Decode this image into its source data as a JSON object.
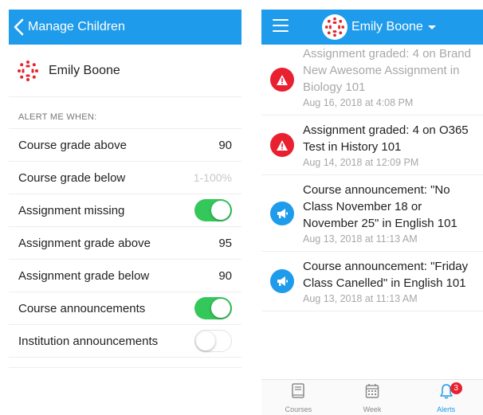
{
  "left": {
    "header": {
      "back_label": "Manage Children"
    },
    "child": {
      "name": "Emily Boone"
    },
    "section_title": "ALERT ME WHEN:",
    "rows": [
      {
        "label": "Course grade above",
        "type": "value",
        "value": "90"
      },
      {
        "label": "Course grade below",
        "type": "placeholder",
        "value": "1-100%"
      },
      {
        "label": "Assignment missing",
        "type": "toggle",
        "on": true
      },
      {
        "label": "Assignment grade above",
        "type": "value",
        "value": "95"
      },
      {
        "label": "Assignment grade below",
        "type": "value",
        "value": "90"
      },
      {
        "label": "Course announcements",
        "type": "toggle",
        "on": true
      },
      {
        "label": "Institution announcements",
        "type": "toggle",
        "on": false
      }
    ]
  },
  "right": {
    "header": {
      "title": "Emily Boone"
    },
    "feed": [
      {
        "kind": "warning",
        "title": "Assignment graded: 4 on Brand New Awesome Assignment in Biology 101",
        "date": "Aug 16, 2018 at 4:08 PM",
        "read": true
      },
      {
        "kind": "warning",
        "title": "Assignment graded: 4 on O365 Test in History 101",
        "date": "Aug 14, 2018 at 12:09 PM",
        "read": false
      },
      {
        "kind": "announcement",
        "title": "Course announcement: \"No Class November 18 or November 25\" in English 101",
        "date": "Aug 13, 2018 at 11:13 AM",
        "read": false
      },
      {
        "kind": "announcement",
        "title": "Course announcement: \"Friday Class Canelled\" in English 101",
        "date": "Aug 13, 2018 at 11:13 AM",
        "read": false
      }
    ],
    "tabs": [
      {
        "label": "Courses",
        "icon": "book-icon",
        "active": false
      },
      {
        "label": "Week",
        "icon": "calendar-icon",
        "active": false
      },
      {
        "label": "Alerts",
        "icon": "bell-icon",
        "active": true,
        "badge": "3"
      }
    ]
  },
  "colors": {
    "brand_blue": "#1e9bea",
    "toggle_green": "#34c759",
    "alert_red": "#e8202f",
    "avatar_red": "#e3242b"
  }
}
